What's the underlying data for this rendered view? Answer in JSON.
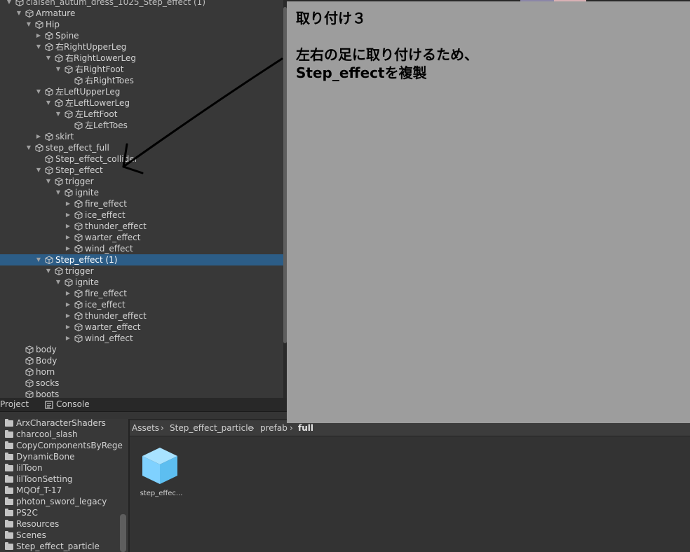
{
  "hierarchy": {
    "rows": [
      {
        "label": "claisen_autum_dress_1025_Step_effect (1)",
        "depth": 0,
        "fold": "open",
        "dim": true
      },
      {
        "label": "Armature",
        "depth": 1,
        "fold": "open"
      },
      {
        "label": "Hip",
        "depth": 2,
        "fold": "open"
      },
      {
        "label": "Spine",
        "depth": 3,
        "fold": "closed"
      },
      {
        "label": "右RightUpperLeg",
        "depth": 3,
        "fold": "open"
      },
      {
        "label": "右RightLowerLeg",
        "depth": 4,
        "fold": "open"
      },
      {
        "label": "右RightFoot",
        "depth": 5,
        "fold": "open"
      },
      {
        "label": "右RightToes",
        "depth": 6,
        "fold": "none"
      },
      {
        "label": "左LeftUpperLeg",
        "depth": 3,
        "fold": "open"
      },
      {
        "label": "左LeftLowerLeg",
        "depth": 4,
        "fold": "open"
      },
      {
        "label": "左LeftFoot",
        "depth": 5,
        "fold": "open"
      },
      {
        "label": "左LeftToes",
        "depth": 6,
        "fold": "none"
      },
      {
        "label": "skirt",
        "depth": 3,
        "fold": "closed"
      },
      {
        "label": "step_effect_full",
        "depth": 2,
        "fold": "open"
      },
      {
        "label": "Step_effect_collider",
        "depth": 3,
        "fold": "none"
      },
      {
        "label": "Step_effect",
        "depth": 3,
        "fold": "open"
      },
      {
        "label": "trigger",
        "depth": 4,
        "fold": "open"
      },
      {
        "label": "ignite",
        "depth": 5,
        "fold": "open"
      },
      {
        "label": "fire_effect",
        "depth": 6,
        "fold": "closed"
      },
      {
        "label": "ice_effect",
        "depth": 6,
        "fold": "closed"
      },
      {
        "label": "thunder_effect",
        "depth": 6,
        "fold": "closed"
      },
      {
        "label": "warter_effect",
        "depth": 6,
        "fold": "closed"
      },
      {
        "label": "wind_effect",
        "depth": 6,
        "fold": "closed"
      },
      {
        "label": "Step_effect (1)",
        "depth": 3,
        "fold": "open",
        "selected": true
      },
      {
        "label": "trigger",
        "depth": 4,
        "fold": "open"
      },
      {
        "label": "ignite",
        "depth": 5,
        "fold": "open"
      },
      {
        "label": "fire_effect",
        "depth": 6,
        "fold": "closed"
      },
      {
        "label": "ice_effect",
        "depth": 6,
        "fold": "closed"
      },
      {
        "label": "thunder_effect",
        "depth": 6,
        "fold": "closed"
      },
      {
        "label": "warter_effect",
        "depth": 6,
        "fold": "closed"
      },
      {
        "label": "wind_effect",
        "depth": 6,
        "fold": "closed"
      },
      {
        "label": "body",
        "depth": 1,
        "fold": "none"
      },
      {
        "label": "Body",
        "depth": 1,
        "fold": "none"
      },
      {
        "label": "horn",
        "depth": 1,
        "fold": "none"
      },
      {
        "label": "socks",
        "depth": 1,
        "fold": "none"
      },
      {
        "label": "boots",
        "depth": 1,
        "fold": "none"
      }
    ]
  },
  "tabs": {
    "project": "Project",
    "console": "Console"
  },
  "project": {
    "folders": [
      "ArxCharacterShaders",
      "charcool_slash",
      "CopyComponentsByRege",
      "DynamicBone",
      "lilToon",
      "lilToonSetting",
      "MQOf_T-17",
      "photon_sword_legacy",
      "PS2C",
      "Resources",
      "Scenes",
      "Step_effect_particle"
    ],
    "breadcrumb": [
      "Assets",
      "Step_effect_particle",
      "prefab",
      "full"
    ],
    "asset_label": "step_effec..."
  },
  "note": {
    "title": "取り付け３",
    "line1": "左右の足に取り付けるため、",
    "line2": "Step_effectを複製"
  },
  "colors": {
    "selection": "#2c5d87",
    "note_bg": "#9d9d9d",
    "prefab_icon": "#7fd1ff"
  }
}
